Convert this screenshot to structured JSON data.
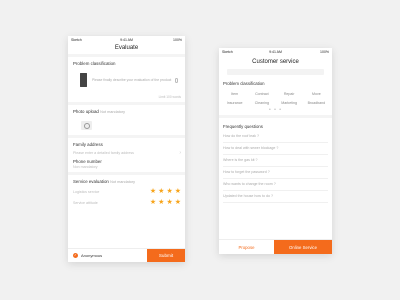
{
  "left": {
    "status": {
      "carrier": "Sketch",
      "time": "9:41 AM",
      "battery": "100%"
    },
    "title": "Evaluate",
    "problem": {
      "label": "Problem classification",
      "placeholder": "Please finally describe your evaluation of the product",
      "limit": "Limit 100 words"
    },
    "photo": {
      "label": "Photo upload",
      "hint": "Not mandatory"
    },
    "family": {
      "label": "Family address",
      "placeholder": "Please enter a detailed family address"
    },
    "phone": {
      "label": "Phone number",
      "placeholder": "Non mandatory"
    },
    "service": {
      "label": "Service evaluation",
      "hint": "Not mandatory",
      "rows": [
        {
          "label": "Logistics service",
          "rating": 4
        },
        {
          "label": "Service attitude",
          "rating": 4
        }
      ],
      "star_color": "#f7a51c"
    },
    "bottom": {
      "anonymous": "Anonymous",
      "submit": "Submit",
      "accent": "#f46b1c"
    }
  },
  "right": {
    "status": {
      "carrier": "Sketch",
      "time": "9:41 AM",
      "battery": "100%"
    },
    "title": "Customer service",
    "problem_title": "Problem classification",
    "categories": [
      "Item",
      "Contract",
      "Repair",
      "Move",
      "Insurance",
      "Cleaning",
      "Marketing",
      "Broadband"
    ],
    "faq_title": "Frequently questions",
    "faq": [
      "How do the roof leak ?",
      "How to deal with sewer blockage ?",
      "Where is the gas kit ?",
      "How to forget the password ?",
      "Who wants to change the room ?",
      "Updated the house how to do ?"
    ],
    "bottom": {
      "propose": "Propose",
      "online": "Online Service"
    }
  }
}
